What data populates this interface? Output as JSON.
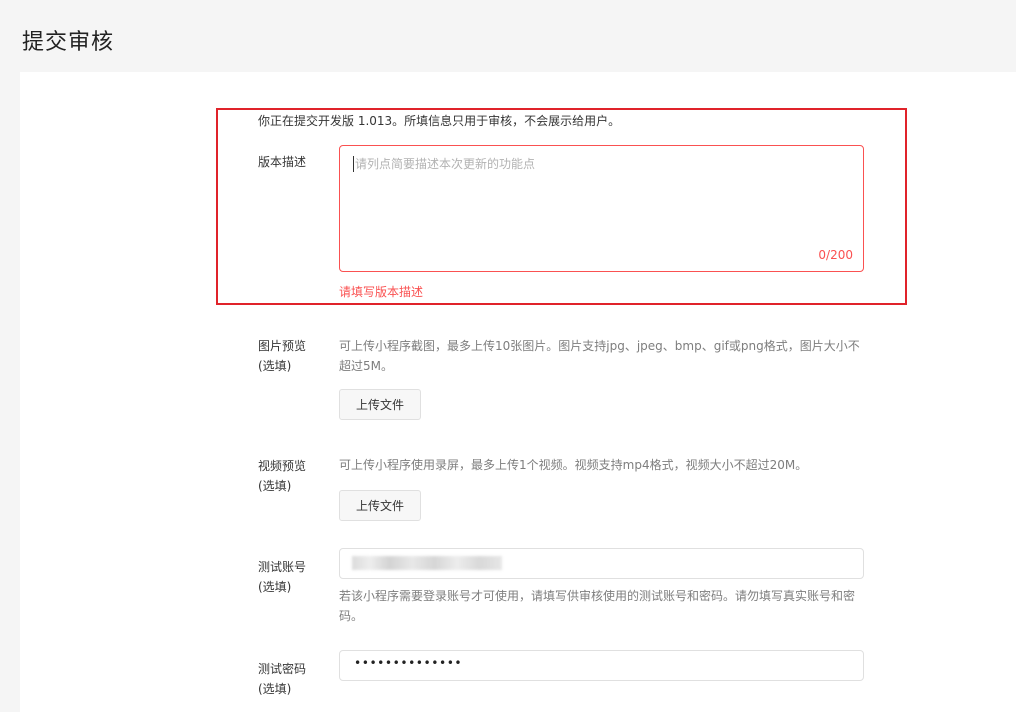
{
  "page": {
    "title": "提交审核"
  },
  "form": {
    "notice": "你正在提交开发版 1.013。所填信息只用于审核，不会展示给用户。",
    "version_desc": {
      "label": "版本描述",
      "placeholder": "请列点简要描述本次更新的功能点",
      "counter": "0/200",
      "error": "请填写版本描述"
    },
    "image_preview": {
      "label_line1": "图片预览",
      "label_line2": "(选填)",
      "desc": "可上传小程序截图，最多上传10张图片。图片支持jpg、jpeg、bmp、gif或png格式，图片大小不超过5M。",
      "button": "上传文件"
    },
    "video_preview": {
      "label_line1": "视频预览",
      "label_line2": "(选填)",
      "desc": "可上传小程序使用录屏，最多上传1个视频。视频支持mp4格式，视频大小不超过20M。",
      "button": "上传文件"
    },
    "test_account": {
      "label_line1": "测试账号",
      "label_line2": "(选填)",
      "desc": "若该小程序需要登录账号才可使用，请填写供审核使用的测试账号和密码。请勿填写真实账号和密码。"
    },
    "test_password": {
      "label_line1": "测试密码",
      "label_line2": "(选填)",
      "value": "••••••••••••••"
    }
  },
  "colors": {
    "error": "#fa5151",
    "highlight": "#e0232a"
  }
}
